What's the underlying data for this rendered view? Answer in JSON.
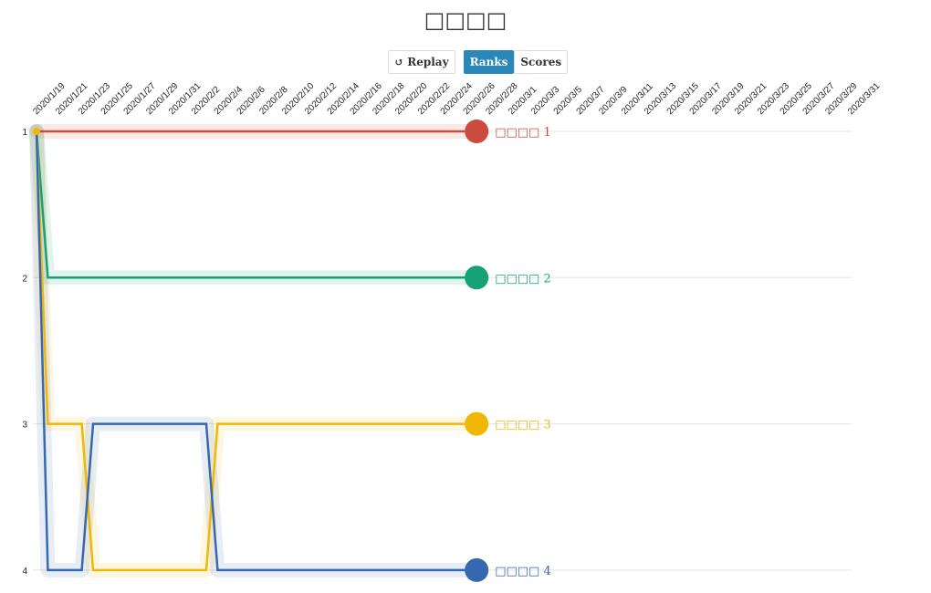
{
  "title": "□□□□",
  "controls": {
    "replay": "Replay",
    "replay_icon": "replay-icon",
    "ranks": "Ranks",
    "scores": "Scores",
    "active": "Ranks"
  },
  "chart_data": {
    "type": "line",
    "subtype": "bump",
    "x_tick_labels": [
      "2020/1/19",
      "2020/1/21",
      "2020/1/23",
      "2020/1/25",
      "2020/1/27",
      "2020/1/29",
      "2020/1/31",
      "2020/2/2",
      "2020/2/4",
      "2020/2/6",
      "2020/2/8",
      "2020/2/10",
      "2020/2/12",
      "2020/2/14",
      "2020/2/16",
      "2020/2/18",
      "2020/2/20",
      "2020/2/22",
      "2020/2/24",
      "2020/2/26",
      "2020/2/28",
      "2020/3/1",
      "2020/3/3",
      "2020/3/5",
      "2020/3/7",
      "2020/3/9",
      "2020/3/11",
      "2020/3/13",
      "2020/3/15",
      "2020/3/17",
      "2020/3/19",
      "2020/3/21",
      "2020/3/23",
      "2020/3/25",
      "2020/3/27",
      "2020/3/29",
      "2020/3/31"
    ],
    "x_start": "2020/1/19",
    "x_end": "2020/3/31",
    "y_ticks": [
      1,
      2,
      3,
      4
    ],
    "y_reversed": true,
    "grid": true,
    "series": [
      {
        "name": "□□□□ 1",
        "color": "#cc4b3c",
        "ranks": [
          1,
          1,
          1,
          1,
          1,
          1,
          1,
          1,
          1,
          1,
          1,
          1,
          1,
          1,
          1,
          1,
          1,
          1,
          1,
          1,
          1,
          1,
          1,
          1,
          1,
          1,
          1,
          1,
          1,
          1,
          1,
          1,
          1,
          1,
          1,
          1,
          1,
          1,
          1
        ]
      },
      {
        "name": "□□□□ 2",
        "color": "#14a276",
        "ranks": [
          1,
          2,
          2,
          2,
          2,
          2,
          2,
          2,
          2,
          2,
          2,
          2,
          2,
          2,
          2,
          2,
          2,
          2,
          2,
          2,
          2,
          2,
          2,
          2,
          2,
          2,
          2,
          2,
          2,
          2,
          2,
          2,
          2,
          2,
          2,
          2,
          2,
          2,
          2
        ]
      },
      {
        "name": "□□□□ 3",
        "color": "#f2b705",
        "ranks": [
          1,
          3,
          3,
          3,
          3,
          4,
          4,
          4,
          4,
          4,
          4,
          4,
          4,
          4,
          4,
          4,
          3,
          3,
          3,
          3,
          3,
          3,
          3,
          3,
          3,
          3,
          3,
          3,
          3,
          3,
          3,
          3,
          3,
          3,
          3,
          3,
          3,
          3,
          3
        ]
      },
      {
        "name": "□□□□ 4",
        "color": "#3767b0",
        "ranks": [
          1,
          4,
          4,
          4,
          4,
          3,
          3,
          3,
          3,
          3,
          3,
          3,
          3,
          3,
          3,
          3,
          4,
          4,
          4,
          4,
          4,
          4,
          4,
          4,
          4,
          4,
          4,
          4,
          4,
          4,
          4,
          4,
          4,
          4,
          4,
          4,
          4,
          4,
          4
        ]
      }
    ]
  }
}
